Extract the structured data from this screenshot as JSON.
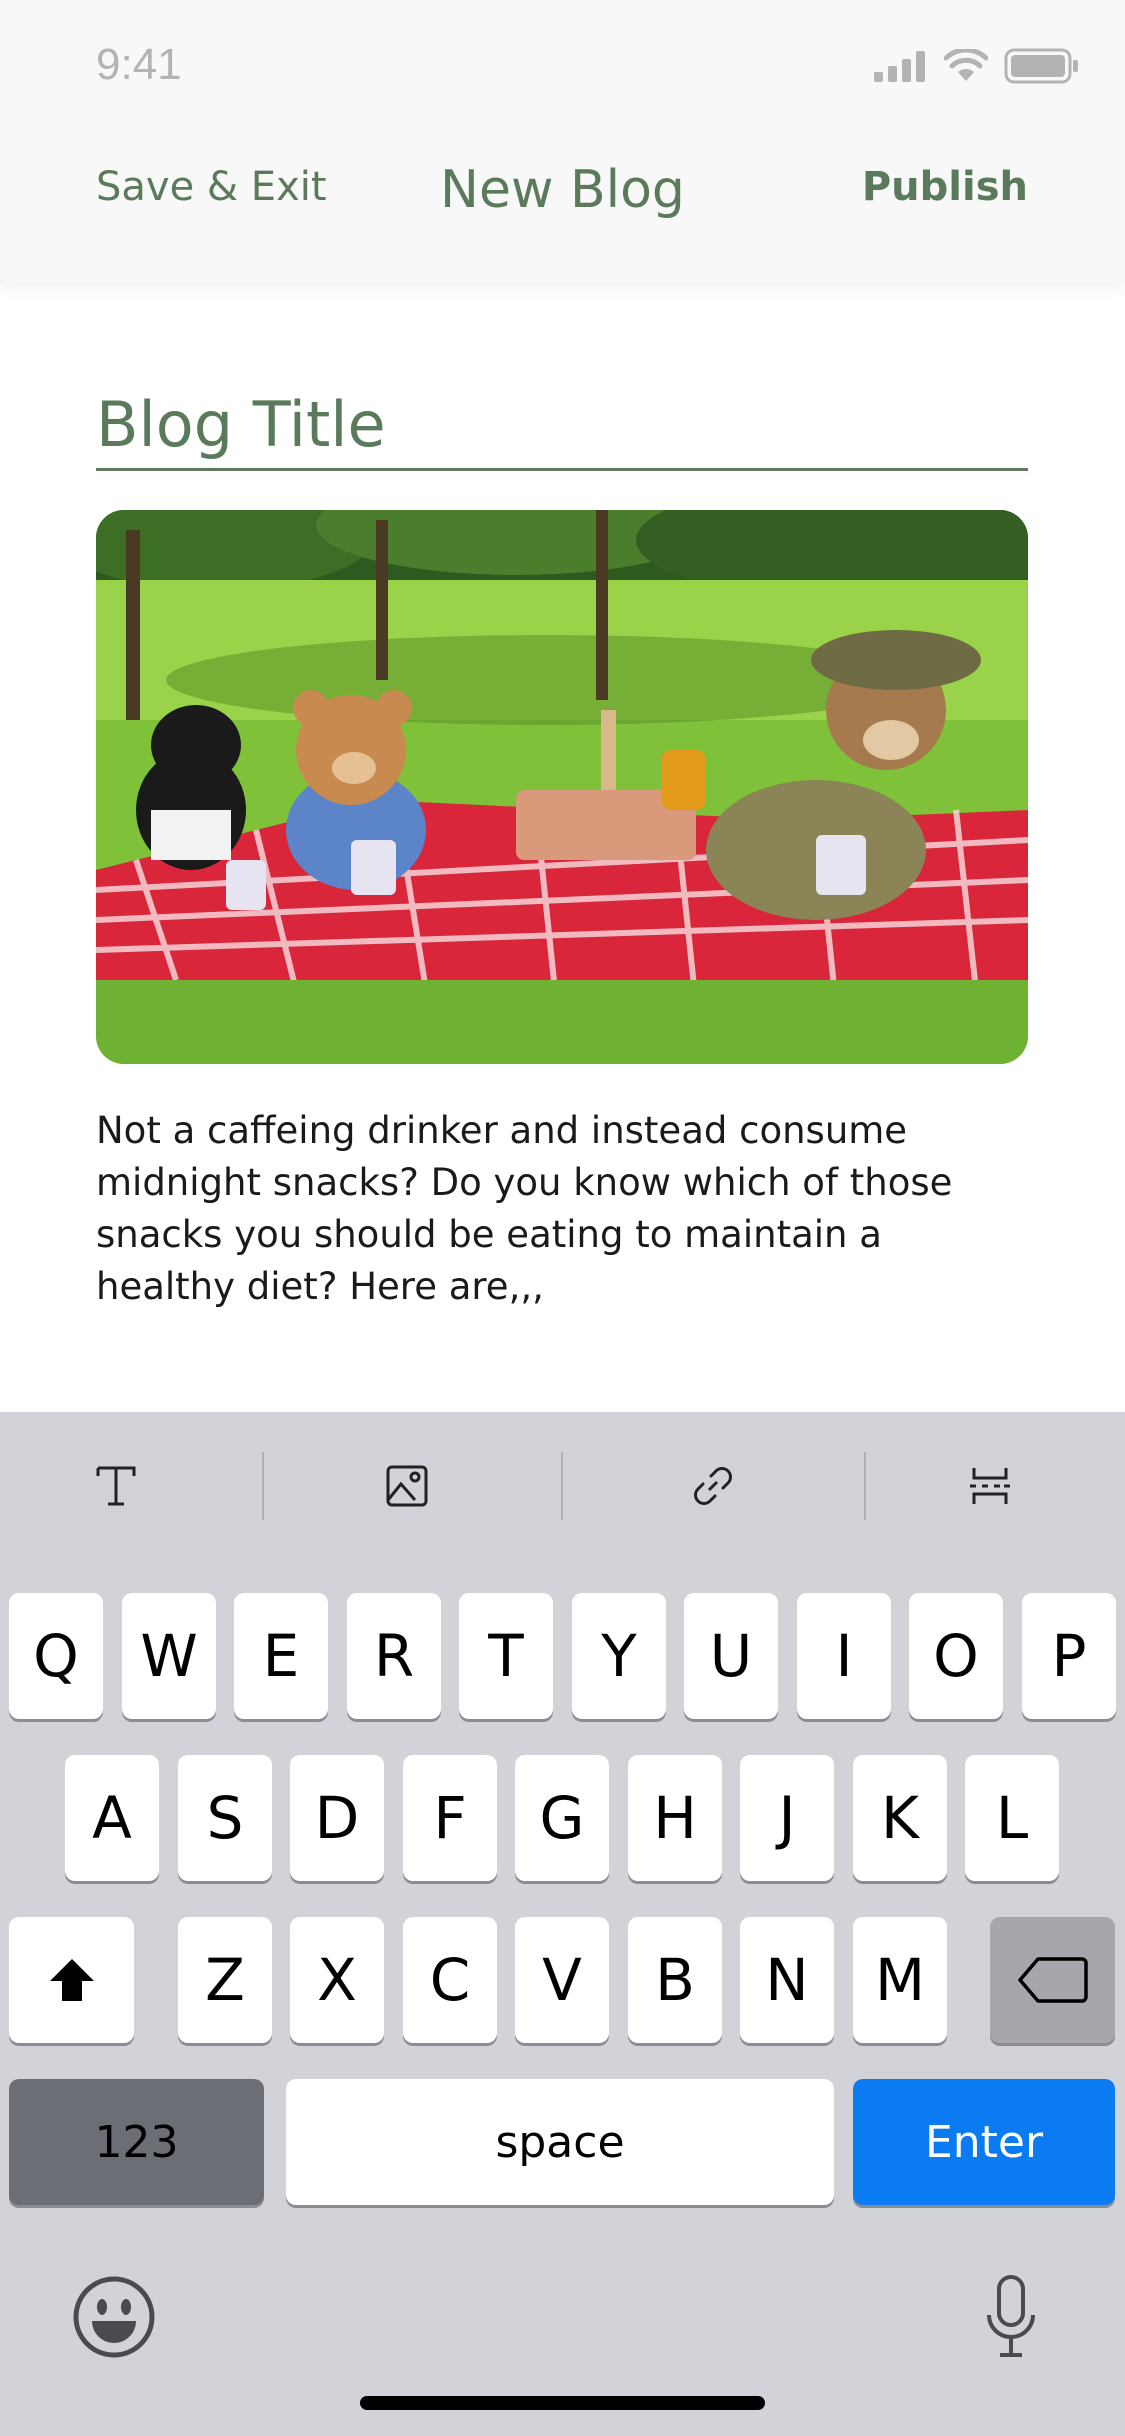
{
  "status_bar": {
    "time": "9:41",
    "icons": [
      "cellular-signal-icon",
      "wifi-icon",
      "battery-icon"
    ]
  },
  "nav": {
    "left_label": "Save & Exit",
    "title": "New Blog",
    "right_label": "Publish"
  },
  "editor": {
    "title_placeholder": "Blog Title",
    "image_icon": "photo-image",
    "body_text": "Not a caffeing drinker and instead consume midnight snacks? Do you know which of those snacks you should be eating to maintain a healthy diet? Here are,,,"
  },
  "format_toolbar": {
    "items": [
      {
        "name": "text-format-icon"
      },
      {
        "name": "insert-image-icon"
      },
      {
        "name": "link-icon"
      },
      {
        "name": "page-break-icon"
      }
    ]
  },
  "keyboard": {
    "row1": [
      "Q",
      "W",
      "E",
      "R",
      "T",
      "Y",
      "U",
      "I",
      "O",
      "P"
    ],
    "row2": [
      "A",
      "S",
      "D",
      "F",
      "G",
      "H",
      "J",
      "K",
      "L"
    ],
    "row3": [
      "Z",
      "X",
      "C",
      "V",
      "B",
      "N",
      "M"
    ],
    "numbers_label": "123",
    "space_label": "space",
    "enter_label": "Enter",
    "icons": [
      "shift-icon",
      "backspace-icon",
      "emoji-icon",
      "microphone-icon"
    ]
  },
  "colors": {
    "accent": "#5a7a5b",
    "enter_key": "#0a7bf0",
    "keyboard_bg": "#d1d3d9"
  }
}
